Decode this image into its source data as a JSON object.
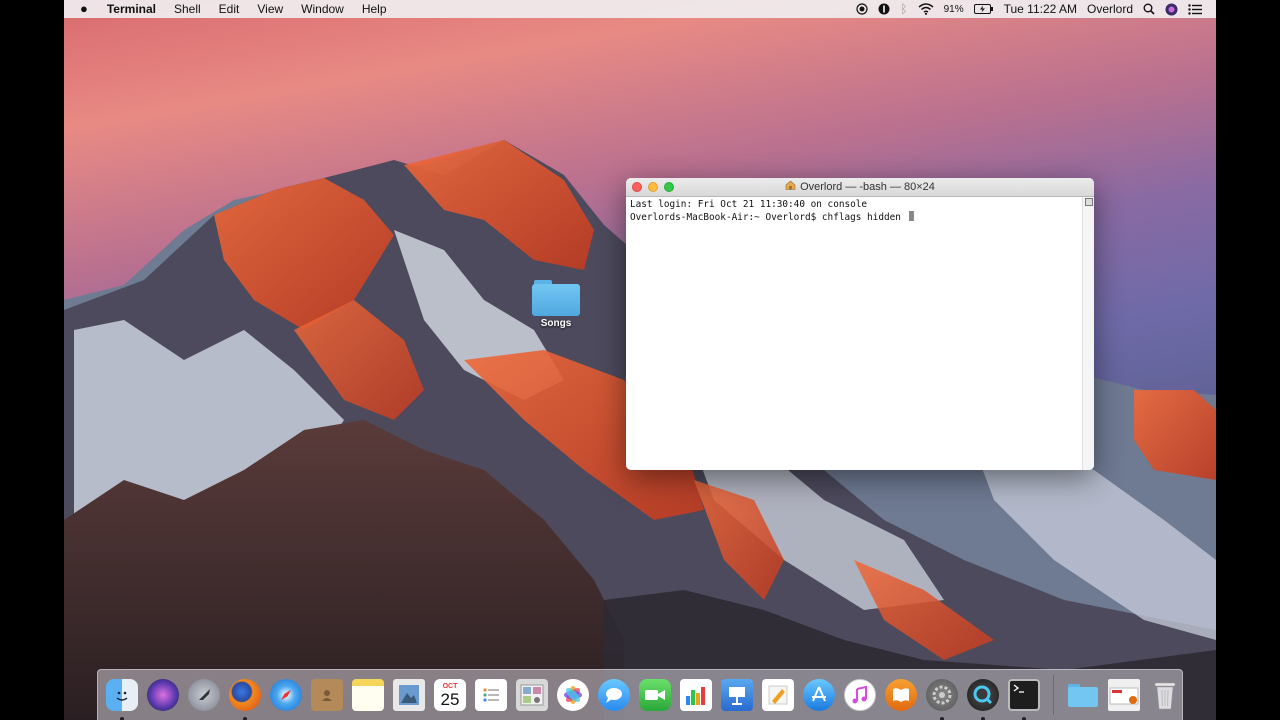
{
  "menubar": {
    "app_name": "Terminal",
    "menus": [
      "Shell",
      "Edit",
      "View",
      "Window",
      "Help"
    ],
    "battery": "91%",
    "clock": "Tue 11:22 AM",
    "user": "Overlord"
  },
  "desktop": {
    "folder_label": "Songs"
  },
  "terminal": {
    "title": "Overlord — -bash — 80×24",
    "line1": "Last login: Fri Oct 21 11:30:40 on console",
    "line2": "Overlords-MacBook-Air:~ Overlord$ chflags hidden "
  },
  "dock": {
    "calendar_month": "OCT",
    "calendar_day": "25",
    "items": [
      "finder",
      "siri",
      "launchpad",
      "firefox",
      "safari",
      "contacts",
      "notes",
      "preview",
      "calendar",
      "reminders",
      "photo-booth",
      "photos",
      "messages",
      "facetime",
      "numbers",
      "keynote",
      "pages",
      "app-store",
      "itunes",
      "ibooks",
      "system-preferences",
      "quicktime",
      "terminal"
    ]
  }
}
